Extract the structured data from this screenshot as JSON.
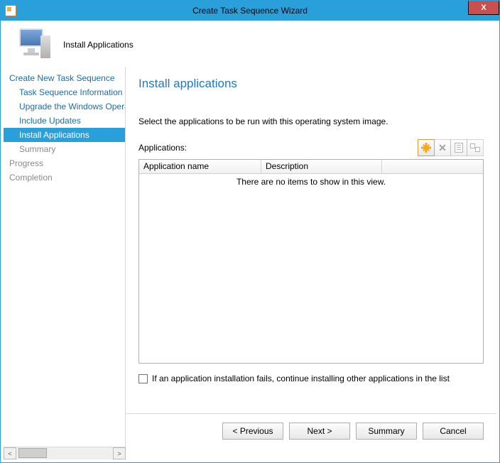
{
  "window": {
    "title": "Create Task Sequence Wizard"
  },
  "header": {
    "subtitle": "Install Applications"
  },
  "sidebar": {
    "items": [
      {
        "label": "Create New Task Sequence",
        "level": 0,
        "state": "link"
      },
      {
        "label": "Task Sequence Information",
        "level": 1,
        "state": "link"
      },
      {
        "label": "Upgrade the Windows Operating System",
        "level": 1,
        "state": "link"
      },
      {
        "label": "Include Updates",
        "level": 1,
        "state": "link"
      },
      {
        "label": "Install Applications",
        "level": 1,
        "state": "selected"
      },
      {
        "label": "Summary",
        "level": 1,
        "state": "disabled"
      },
      {
        "label": "Progress",
        "level": 0,
        "state": "disabled"
      },
      {
        "label": "Completion",
        "level": 0,
        "state": "disabled"
      }
    ]
  },
  "panel": {
    "title": "Install applications",
    "instruction": "Select the applications to be run with this operating system image.",
    "applications_label": "Applications:",
    "columns": {
      "name": "Application name",
      "description": "Description"
    },
    "empty_text": "There are no items to show in this view.",
    "checkbox_label": "If an application installation fails, continue installing other applications in the list",
    "checkbox_checked": false
  },
  "toolbar": {
    "new": "new",
    "delete": "delete",
    "properties": "properties",
    "dependencies": "dependencies"
  },
  "buttons": {
    "previous": "< Previous",
    "next": "Next >",
    "summary": "Summary",
    "cancel": "Cancel"
  }
}
